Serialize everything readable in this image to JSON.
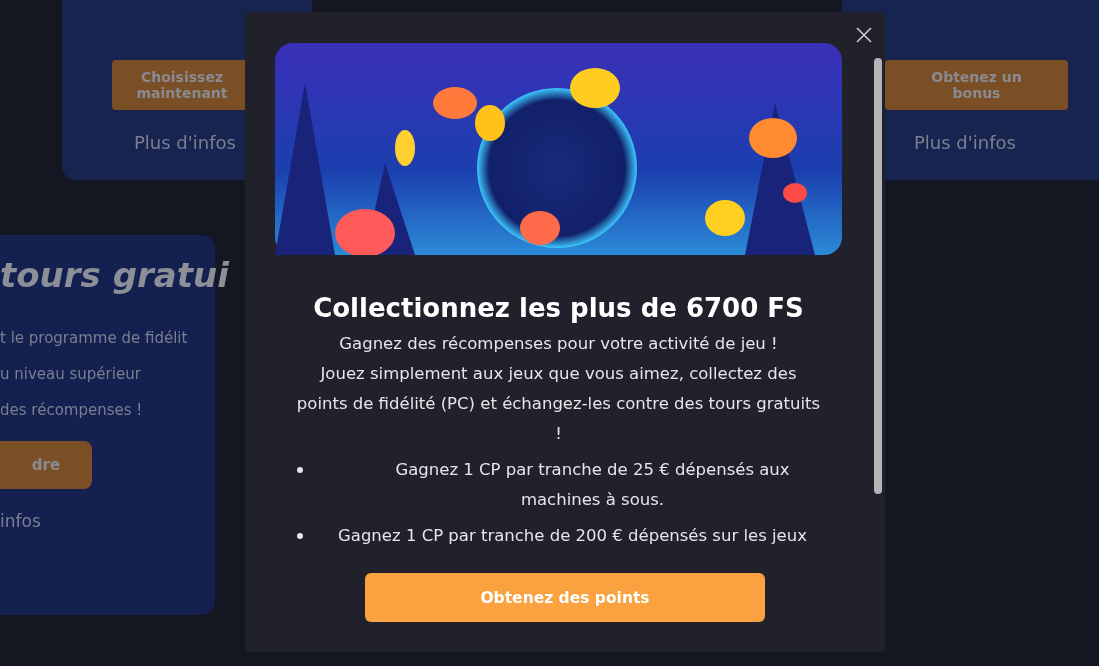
{
  "background_cards": [
    {
      "button": "Choisissez maintenant",
      "link": "Plus d'infos"
    },
    {
      "button": "Obtenez un bonus",
      "link": "Plus d'infos"
    }
  ],
  "promo_card": {
    "title": "tours gratui",
    "lines": [
      "t le programme de fidélit",
      "u niveau supérieur",
      "des récompenses !"
    ],
    "button": "dre",
    "link": "infos"
  },
  "modal": {
    "title": "Collectionnez les plus de 6700 FS",
    "paragraphs": [
      "Gagnez des récompenses pour votre activité de jeu !",
      "Jouez simplement aux jeux que vous aimez, collectez des points de fidélité (PC) et échangez-les contre des tours gratuits !"
    ],
    "bullets": [
      "Gagnez 1 CP par tranche de 25 € dépensés aux machines à sous.",
      "Gagnez 1 CP par tranche de 200 € dépensés sur les jeux"
    ],
    "button": "Obtenez des points"
  }
}
